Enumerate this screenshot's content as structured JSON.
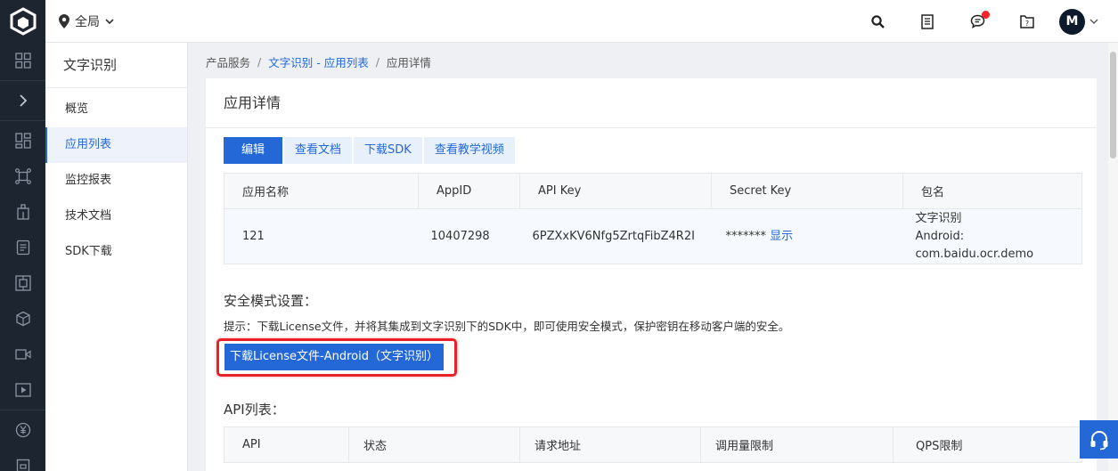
{
  "header": {
    "region_label": "全局",
    "avatar_letter": "M",
    "icons": [
      "search-icon",
      "document-icon",
      "message-icon",
      "help-icon"
    ]
  },
  "rail": {
    "icons": [
      "grid-icon",
      "chevron-right-icon",
      "dashboard-icon",
      "network-icon",
      "building-icon",
      "doc-icon",
      "layers-icon",
      "cube-icon",
      "video-icon",
      "play-icon",
      "yen-icon",
      "box-icon"
    ]
  },
  "sidebar": {
    "title": "文字识别",
    "items": [
      {
        "label": "概览"
      },
      {
        "label": "应用列表"
      },
      {
        "label": "监控报表"
      },
      {
        "label": "技术文档"
      },
      {
        "label": "SDK下载"
      }
    ]
  },
  "breadcrumb": {
    "root": "产品服务",
    "middle": "文字识别 - 应用列表",
    "current": "应用详情",
    "separator": "/"
  },
  "main": {
    "title": "应用详情",
    "buttons": {
      "edit": "编辑",
      "docs": "查看文档",
      "sdk": "下载SDK",
      "video": "查看教学视频"
    },
    "app_table": {
      "headers": [
        "应用名称",
        "AppID",
        "API Key",
        "Secret Key",
        "包名"
      ],
      "row": {
        "name": "121",
        "app_id": "10407298",
        "api_key": "6PZXxKV6Nfg5ZrtqFibZ4R2I",
        "secret_key": "*******",
        "show_label": "显示",
        "package_title": "文字识别",
        "package_value": "Android: com.baidu.ocr.demo"
      }
    },
    "security": {
      "title": "安全模式设置：",
      "hint": "提示：下载License文件，并将其集成到文字识别下的SDK中，即可使用安全模式，保护密钥在移动客户端的安全。",
      "download_label": "下载License文件-Android（文字识别）"
    },
    "api_list": {
      "title": "API列表：",
      "headers": [
        "API",
        "状态",
        "请求地址",
        "调用量限制",
        "QPS限制"
      ]
    }
  },
  "colors": {
    "accent": "#2468d8",
    "dark_rail": "#1d2630",
    "highlight": "#e8222a"
  }
}
